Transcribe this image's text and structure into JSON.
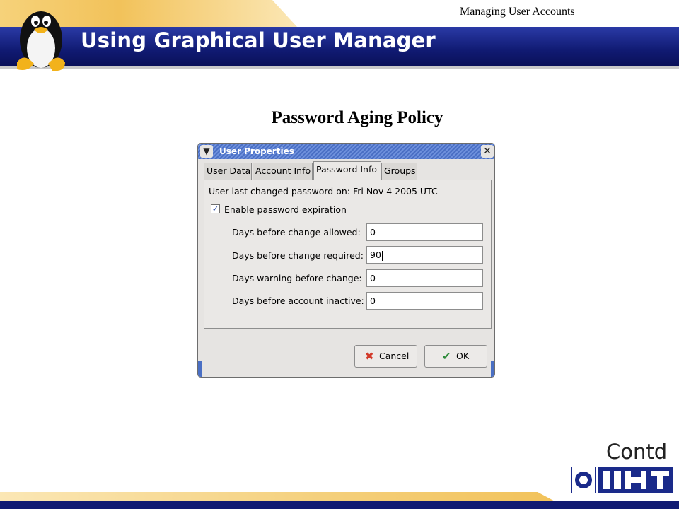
{
  "slide": {
    "top_label": "Managing User Accounts",
    "title": "Using Graphical User Manager",
    "section_heading": "Password Aging Policy",
    "contd": "Contd"
  },
  "dialog": {
    "title": "User Properties",
    "tabs": [
      {
        "label": "User Data",
        "active": false
      },
      {
        "label": "Account Info",
        "active": false
      },
      {
        "label": "Password Info",
        "active": true
      },
      {
        "label": "Groups",
        "active": false
      }
    ],
    "last_changed": "User last changed password on:  Fri  Nov  4  2005  UTC",
    "enable_expiration": {
      "label": "Enable password expiration",
      "checked": true
    },
    "fields": [
      {
        "label": "Days before change allowed:",
        "value": "0"
      },
      {
        "label": "Days before change required:",
        "value": "90"
      },
      {
        "label": "Days warning before change:",
        "value": "0"
      },
      {
        "label": "Days before account inactive:",
        "value": "0"
      }
    ],
    "buttons": {
      "cancel": "Cancel",
      "ok": "OK"
    }
  },
  "colors": {
    "header_blue": "#101a72",
    "header_gold": "#f2c25a",
    "titlebar_blue": "#4a6fc4",
    "dialog_bg": "#e6e4e2"
  },
  "icons": [
    "penguin-logo",
    "window-menu-icon",
    "close-icon",
    "checkbox-check-icon",
    "cancel-x-icon",
    "ok-check-icon",
    "iiht-logo"
  ]
}
